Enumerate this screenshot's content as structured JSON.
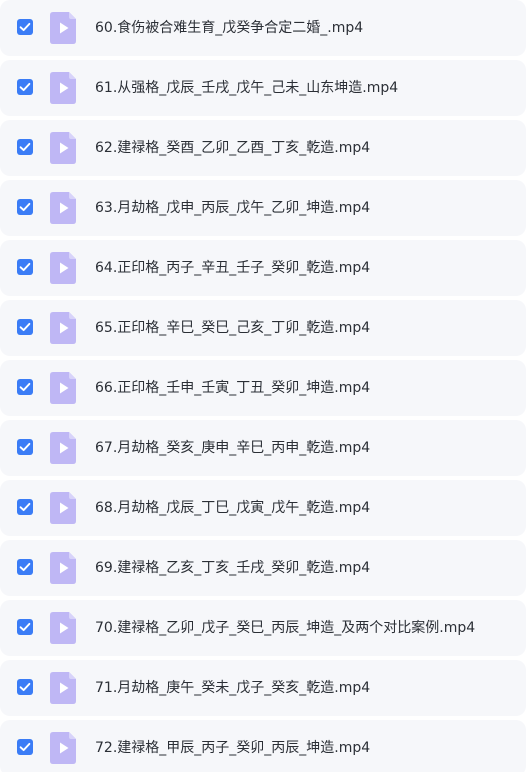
{
  "colors": {
    "checkbox": "#3b7cf6",
    "file_icon": "#bfb7f5",
    "row_background": "#f6f7fa",
    "text": "#2b2f36"
  },
  "files": [
    {
      "name": "60.食伤被合难生育_戊癸争合定二婚_.mp4",
      "checked": true,
      "icon": "video-play-icon"
    },
    {
      "name": "61.从强格_戊辰_壬戌_戊午_己未_山东坤造.mp4",
      "checked": true,
      "icon": "video-play-icon"
    },
    {
      "name": "62.建禄格_癸酉_乙卯_乙酉_丁亥_乾造.mp4",
      "checked": true,
      "icon": "video-play-icon"
    },
    {
      "name": "63.月劫格_戊申_丙辰_戊午_乙卯_坤造.mp4",
      "checked": true,
      "icon": "video-play-icon"
    },
    {
      "name": "64.正印格_丙子_辛丑_壬子_癸卯_乾造.mp4",
      "checked": true,
      "icon": "video-play-icon"
    },
    {
      "name": "65.正印格_辛巳_癸巳_己亥_丁卯_乾造.mp4",
      "checked": true,
      "icon": "video-play-icon"
    },
    {
      "name": "66.正印格_壬申_壬寅_丁丑_癸卯_坤造.mp4",
      "checked": true,
      "icon": "video-play-icon"
    },
    {
      "name": "67.月劫格_癸亥_庚申_辛巳_丙申_乾造.mp4",
      "checked": true,
      "icon": "video-play-icon"
    },
    {
      "name": "68.月劫格_戊辰_丁巳_戊寅_戊午_乾造.mp4",
      "checked": true,
      "icon": "video-play-icon"
    },
    {
      "name": "69.建禄格_乙亥_丁亥_壬戌_癸卯_乾造.mp4",
      "checked": true,
      "icon": "video-play-icon"
    },
    {
      "name": "70.建禄格_乙卯_戊子_癸巳_丙辰_坤造_及两个对比案例.mp4",
      "checked": true,
      "icon": "video-play-icon"
    },
    {
      "name": "71.月劫格_庚午_癸未_戊子_癸亥_乾造.mp4",
      "checked": true,
      "icon": "video-play-icon"
    },
    {
      "name": "72.建禄格_甲辰_丙子_癸卯_丙辰_坤造.mp4",
      "checked": true,
      "icon": "video-play-icon"
    }
  ]
}
